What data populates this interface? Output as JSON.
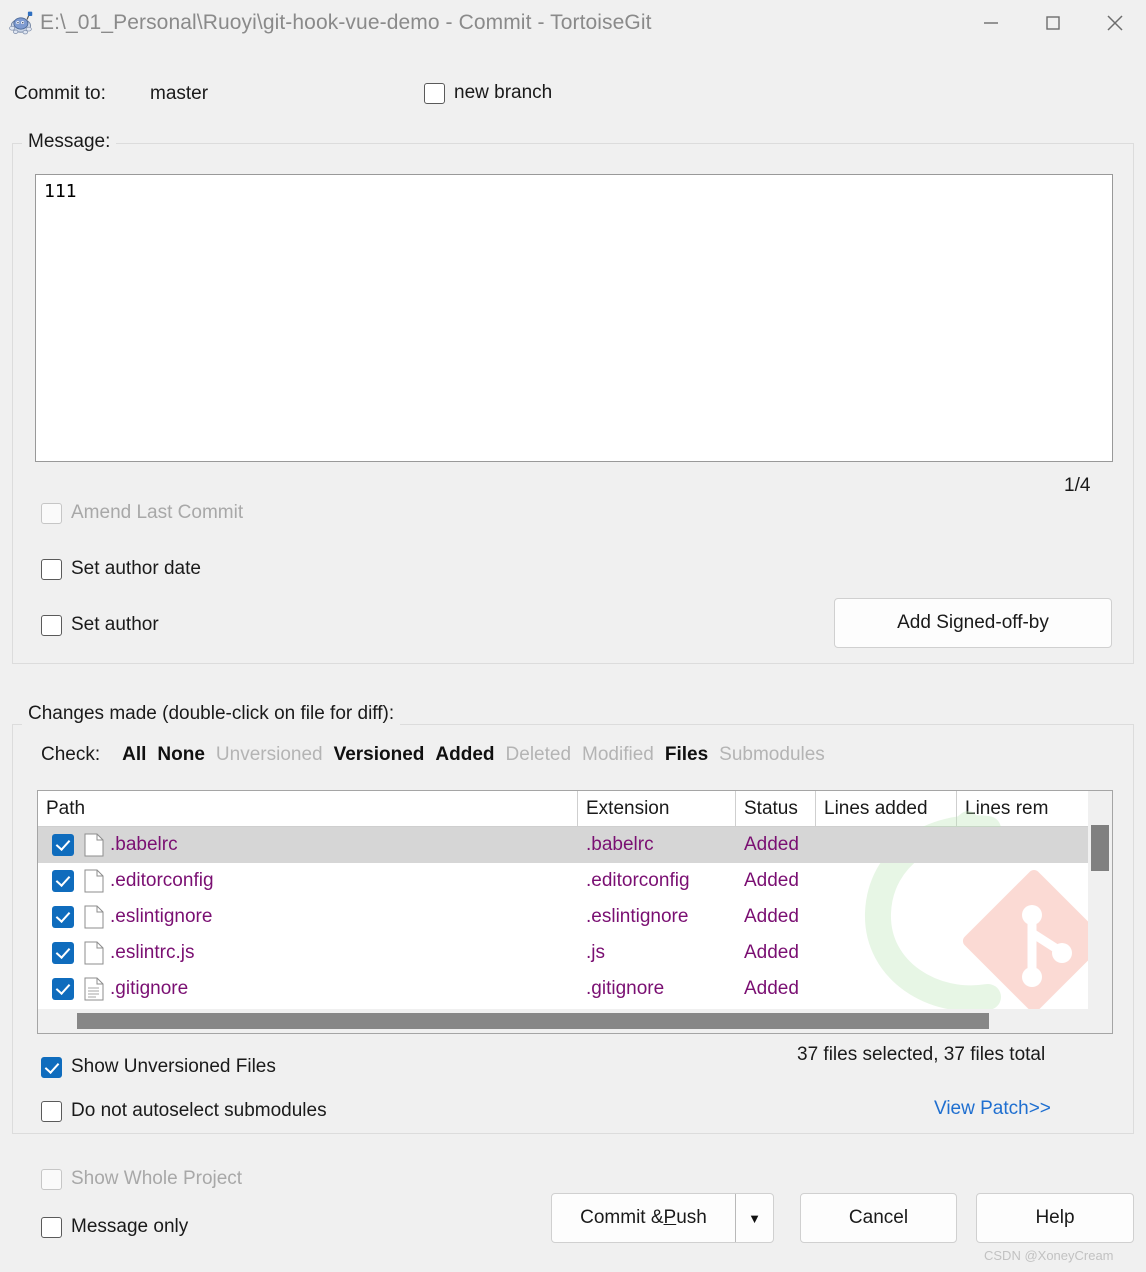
{
  "window": {
    "title": "E:\\_01_Personal\\Ruoyi\\git-hook-vue-demo - Commit - TortoiseGit",
    "app_icon": "tortoisegit-turtle-icon",
    "minimize_label": "—",
    "maximize_label": "□",
    "close_label": "✕"
  },
  "commit_to": {
    "label": "Commit to:",
    "branch": "master",
    "new_branch_label": "new branch",
    "new_branch_checked": false
  },
  "message": {
    "group_title": "Message:",
    "value": "111",
    "counter": "1/4"
  },
  "options": {
    "amend_last_commit": {
      "label": "Amend Last Commit",
      "checked": false,
      "disabled": true
    },
    "set_author_date": {
      "label": "Set author date",
      "checked": false,
      "disabled": false
    },
    "set_author": {
      "label": "Set author",
      "checked": false,
      "disabled": false
    },
    "add_signed_off_by": "Add Signed-off-by"
  },
  "changes": {
    "group_title": "Changes made (double-click on file for diff):",
    "check_label": "Check:",
    "check_links": [
      {
        "label": "All",
        "enabled": true
      },
      {
        "label": "None",
        "enabled": true
      },
      {
        "label": "Unversioned",
        "enabled": false
      },
      {
        "label": "Versioned",
        "enabled": true
      },
      {
        "label": "Added",
        "enabled": true
      },
      {
        "label": "Deleted",
        "enabled": false
      },
      {
        "label": "Modified",
        "enabled": false
      },
      {
        "label": "Files",
        "enabled": true
      },
      {
        "label": "Submodules",
        "enabled": false
      }
    ],
    "columns": [
      "Path",
      "Extension",
      "Status",
      "Lines added",
      "Lines rem"
    ],
    "rows": [
      {
        "checked": true,
        "icon": "file-icon",
        "path": ".babelrc",
        "extension": ".babelrc",
        "status": "Added",
        "lines_added": "",
        "lines_removed": "",
        "selected": true
      },
      {
        "checked": true,
        "icon": "file-icon",
        "path": ".editorconfig",
        "extension": ".editorconfig",
        "status": "Added",
        "lines_added": "",
        "lines_removed": "",
        "selected": false
      },
      {
        "checked": true,
        "icon": "file-icon",
        "path": ".eslintignore",
        "extension": ".eslintignore",
        "status": "Added",
        "lines_added": "",
        "lines_removed": "",
        "selected": false
      },
      {
        "checked": true,
        "icon": "file-icon",
        "path": ".eslintrc.js",
        "extension": ".js",
        "status": "Added",
        "lines_added": "",
        "lines_removed": "",
        "selected": false
      },
      {
        "checked": true,
        "icon": "text-file-icon",
        "path": ".gitignore",
        "extension": ".gitignore",
        "status": "Added",
        "lines_added": "",
        "lines_removed": "",
        "selected": false
      }
    ],
    "status_summary": "37 files selected, 37 files total",
    "view_patch": "View Patch>>",
    "show_unversioned": {
      "label": "Show Unversioned Files",
      "checked": true,
      "disabled": false
    },
    "no_autoselect_submodules": {
      "label": "Do not autoselect submodules",
      "checked": false,
      "disabled": false
    }
  },
  "footer": {
    "show_whole_project": {
      "label": "Show Whole Project",
      "checked": false,
      "disabled": true
    },
    "message_only": {
      "label": "Message only",
      "checked": false,
      "disabled": false
    },
    "commit_push_pre": "Commit & ",
    "commit_push_accel": "P",
    "commit_push_post": "ush",
    "dropdown_icon": "▼",
    "cancel": "Cancel",
    "help": "Help"
  },
  "watermark": "CSDN @XoneyCream",
  "colors": {
    "accent_blue": "#0f6cbd",
    "status_purple": "#7a0f72",
    "link_blue": "#1f6fd0",
    "window_bg": "#f0f0f0",
    "git_logo": "#f08878",
    "c_logo": "#bfe6bb"
  }
}
